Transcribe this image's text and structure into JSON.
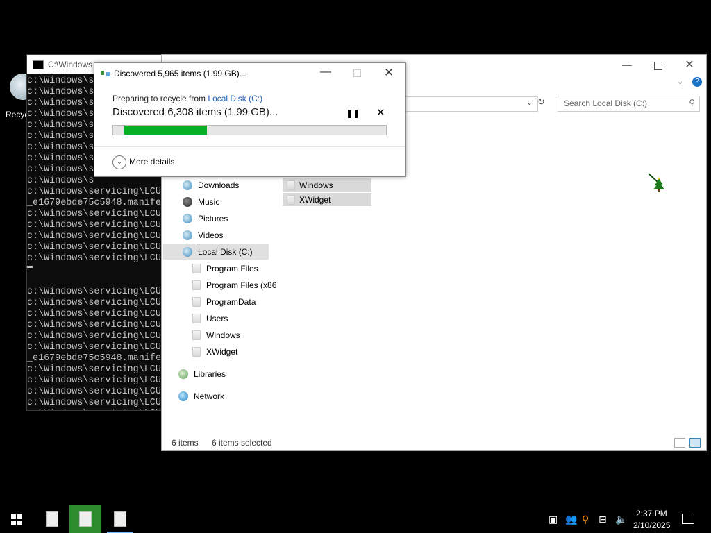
{
  "desktop": {
    "recycle_label": "Recycle"
  },
  "cmd": {
    "title": "C:\\Windows",
    "lines": [
      "c:\\Windows\\s",
      "c:\\Windows\\s",
      "c:\\Windows\\s",
      "c:\\Windows\\s",
      "c:\\Windows\\s",
      "c:\\Windows\\s",
      "c:\\Windows\\s",
      "c:\\Windows\\s",
      "c:\\Windows\\s",
      "c:\\Windows\\s",
      "c:\\Windows\\servicing\\LCU",
      "_e1679ebde75c5948.manife",
      "c:\\Windows\\servicing\\LCU",
      "c:\\Windows\\servicing\\LCU",
      "c:\\Windows\\servicing\\LCU",
      "c:\\Windows\\servicing\\LCU",
      "c:\\Windows\\servicing\\LCU",
      "",
      "",
      "c:\\Windows\\servicing\\LCU",
      "c:\\Windows\\servicing\\LCU",
      "c:\\Windows\\servicing\\LCU",
      "c:\\Windows\\servicing\\LCU",
      "c:\\Windows\\servicing\\LCU",
      "c:\\Windows\\servicing\\LCU",
      "_e1679ebde75c5948.manife",
      "c:\\Windows\\servicing\\LCU",
      "c:\\Windows\\servicing\\LCU",
      "c:\\Windows\\servicing\\LCU",
      "c:\\Windows\\servicing\\LCU",
      "c:\\Windows\\servicing\\LCU"
    ]
  },
  "explorer": {
    "search_placeholder": "Search Local Disk (C:)",
    "nav": [
      {
        "label": "Downloads",
        "icon": "downloads-icon"
      },
      {
        "label": "Music",
        "icon": "music-icon"
      },
      {
        "label": "Pictures",
        "icon": "pictures-icon"
      },
      {
        "label": "Videos",
        "icon": "videos-icon"
      },
      {
        "label": "Local Disk (C:)",
        "icon": "drive-icon"
      },
      {
        "label": "Program Files",
        "icon": "folder-icon"
      },
      {
        "label": "Program Files (x86",
        "icon": "folder-icon"
      },
      {
        "label": "ProgramData",
        "icon": "folder-icon"
      },
      {
        "label": "Users",
        "icon": "folder-icon"
      },
      {
        "label": "Windows",
        "icon": "folder-icon"
      },
      {
        "label": "XWidget",
        "icon": "folder-icon"
      },
      {
        "label": "Libraries",
        "icon": "libraries-icon"
      },
      {
        "label": "Network",
        "icon": "network-icon"
      }
    ],
    "files": [
      {
        "label": "Windows"
      },
      {
        "label": "XWidget"
      }
    ],
    "status_count": "6 items",
    "status_selected": "6 items selected"
  },
  "dialog": {
    "title": "Discovered 5,965 items (1.99 GB)...",
    "preparing_prefix": "Preparing to recycle from ",
    "preparing_link": "Local Disk (C:)",
    "discovered": "Discovered 6,308 items (1.99 GB)...",
    "progress_fraction": 0.33,
    "more_details": "More details",
    "progress_color": "#06b025"
  },
  "taskbar": {
    "time": "2:37 PM",
    "date": "2/10/2025"
  }
}
